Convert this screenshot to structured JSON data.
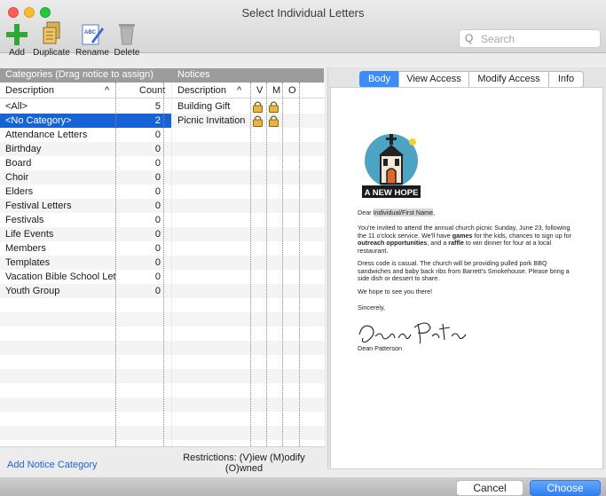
{
  "window": {
    "title": "Select Individual Letters"
  },
  "toolbar": {
    "add_label": "Add",
    "duplicate_label": "Duplicate",
    "rename_label": "Rename",
    "delete_label": "Delete"
  },
  "search": {
    "placeholder": "Search"
  },
  "categories": {
    "header": "Categories (Drag notice to assign)",
    "col_description": "Description",
    "col_count": "Count",
    "sort_indicator": "^",
    "rows": [
      {
        "description": "<All>",
        "count": "5"
      },
      {
        "description": "<No Category>",
        "count": "2"
      },
      {
        "description": "Attendance Letters",
        "count": "0"
      },
      {
        "description": "Birthday",
        "count": "0"
      },
      {
        "description": "Board",
        "count": "0"
      },
      {
        "description": "Choir",
        "count": "0"
      },
      {
        "description": "Elders",
        "count": "0"
      },
      {
        "description": "Festival Letters",
        "count": "0"
      },
      {
        "description": "Festivals",
        "count": "0"
      },
      {
        "description": "Life Events",
        "count": "0"
      },
      {
        "description": "Members",
        "count": "0"
      },
      {
        "description": "Templates",
        "count": "0"
      },
      {
        "description": "Vacation Bible School Let",
        "count": "0"
      },
      {
        "description": "Youth Group",
        "count": "0"
      }
    ],
    "selected_index": 1,
    "add_link": "Add Notice Category"
  },
  "notices": {
    "header": "Notices",
    "col_description": "Description",
    "sort_indicator": "^",
    "col_v": "V",
    "col_m": "M",
    "col_o": "O",
    "rows": [
      {
        "description": "Building Gift",
        "v": "lock-icon",
        "m": "lock-icon"
      },
      {
        "description": "Picnic Invitation",
        "v": "lock-icon",
        "m": "lock-icon"
      }
    ],
    "selected_index": 1,
    "restrictions_line1": "Restrictions: (V)iew (M)odify",
    "restrictions_line2": "(O)wned"
  },
  "preview": {
    "tabs": [
      "Body",
      "View Access",
      "Modify Access",
      "Info"
    ],
    "active_tab": "Body",
    "logo_text": "A NEW HOPE",
    "letter": {
      "greeting_prefix": "Dear ",
      "greeting_field": "Individual/First Name",
      "greeting_suffix": ",",
      "p1_a": "You're invited to attend the annual church picnic Sunday, June 23, following the 11 o'clock service. We'll have ",
      "p1_b": "games",
      "p1_c": " for the kids, chances to sign up for ",
      "p1_d": "outreach opportunities",
      "p1_e": ", and a ",
      "p1_f": "raffle",
      "p1_g": " to win dinner for four at a local restaurant.",
      "p2": "Dress code is casual. The church will be providing pulled pork BBQ sandwiches and baby back ribs from Barrett's Smokehouse. Please bring a side dish or dessert to share.",
      "p3": "We hope to see you there!",
      "closing": "Sincerely,",
      "signer": "Dean Patterson"
    }
  },
  "footer": {
    "cancel_label": "Cancel",
    "choose_label": "Choose"
  },
  "colors": {
    "selection": "#1763d6",
    "accent_button": "#3b8cf5",
    "add_green": "#2fa838",
    "link": "#1d63d4"
  }
}
